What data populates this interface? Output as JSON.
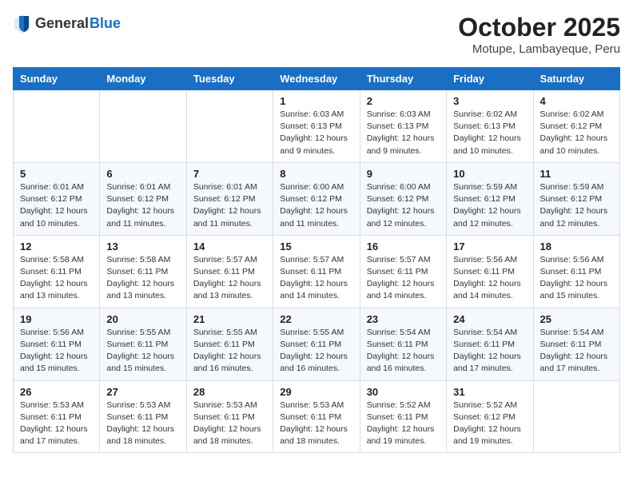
{
  "header": {
    "logo_general": "General",
    "logo_blue": "Blue",
    "month": "October 2025",
    "location": "Motupe, Lambayeque, Peru"
  },
  "days_of_week": [
    "Sunday",
    "Monday",
    "Tuesday",
    "Wednesday",
    "Thursday",
    "Friday",
    "Saturday"
  ],
  "weeks": [
    [
      {
        "day": "",
        "info": ""
      },
      {
        "day": "",
        "info": ""
      },
      {
        "day": "",
        "info": ""
      },
      {
        "day": "1",
        "info": "Sunrise: 6:03 AM\nSunset: 6:13 PM\nDaylight: 12 hours\nand 9 minutes."
      },
      {
        "day": "2",
        "info": "Sunrise: 6:03 AM\nSunset: 6:13 PM\nDaylight: 12 hours\nand 9 minutes."
      },
      {
        "day": "3",
        "info": "Sunrise: 6:02 AM\nSunset: 6:13 PM\nDaylight: 12 hours\nand 10 minutes."
      },
      {
        "day": "4",
        "info": "Sunrise: 6:02 AM\nSunset: 6:12 PM\nDaylight: 12 hours\nand 10 minutes."
      }
    ],
    [
      {
        "day": "5",
        "info": "Sunrise: 6:01 AM\nSunset: 6:12 PM\nDaylight: 12 hours\nand 10 minutes."
      },
      {
        "day": "6",
        "info": "Sunrise: 6:01 AM\nSunset: 6:12 PM\nDaylight: 12 hours\nand 11 minutes."
      },
      {
        "day": "7",
        "info": "Sunrise: 6:01 AM\nSunset: 6:12 PM\nDaylight: 12 hours\nand 11 minutes."
      },
      {
        "day": "8",
        "info": "Sunrise: 6:00 AM\nSunset: 6:12 PM\nDaylight: 12 hours\nand 11 minutes."
      },
      {
        "day": "9",
        "info": "Sunrise: 6:00 AM\nSunset: 6:12 PM\nDaylight: 12 hours\nand 12 minutes."
      },
      {
        "day": "10",
        "info": "Sunrise: 5:59 AM\nSunset: 6:12 PM\nDaylight: 12 hours\nand 12 minutes."
      },
      {
        "day": "11",
        "info": "Sunrise: 5:59 AM\nSunset: 6:12 PM\nDaylight: 12 hours\nand 12 minutes."
      }
    ],
    [
      {
        "day": "12",
        "info": "Sunrise: 5:58 AM\nSunset: 6:11 PM\nDaylight: 12 hours\nand 13 minutes."
      },
      {
        "day": "13",
        "info": "Sunrise: 5:58 AM\nSunset: 6:11 PM\nDaylight: 12 hours\nand 13 minutes."
      },
      {
        "day": "14",
        "info": "Sunrise: 5:57 AM\nSunset: 6:11 PM\nDaylight: 12 hours\nand 13 minutes."
      },
      {
        "day": "15",
        "info": "Sunrise: 5:57 AM\nSunset: 6:11 PM\nDaylight: 12 hours\nand 14 minutes."
      },
      {
        "day": "16",
        "info": "Sunrise: 5:57 AM\nSunset: 6:11 PM\nDaylight: 12 hours\nand 14 minutes."
      },
      {
        "day": "17",
        "info": "Sunrise: 5:56 AM\nSunset: 6:11 PM\nDaylight: 12 hours\nand 14 minutes."
      },
      {
        "day": "18",
        "info": "Sunrise: 5:56 AM\nSunset: 6:11 PM\nDaylight: 12 hours\nand 15 minutes."
      }
    ],
    [
      {
        "day": "19",
        "info": "Sunrise: 5:56 AM\nSunset: 6:11 PM\nDaylight: 12 hours\nand 15 minutes."
      },
      {
        "day": "20",
        "info": "Sunrise: 5:55 AM\nSunset: 6:11 PM\nDaylight: 12 hours\nand 15 minutes."
      },
      {
        "day": "21",
        "info": "Sunrise: 5:55 AM\nSunset: 6:11 PM\nDaylight: 12 hours\nand 16 minutes."
      },
      {
        "day": "22",
        "info": "Sunrise: 5:55 AM\nSunset: 6:11 PM\nDaylight: 12 hours\nand 16 minutes."
      },
      {
        "day": "23",
        "info": "Sunrise: 5:54 AM\nSunset: 6:11 PM\nDaylight: 12 hours\nand 16 minutes."
      },
      {
        "day": "24",
        "info": "Sunrise: 5:54 AM\nSunset: 6:11 PM\nDaylight: 12 hours\nand 17 minutes."
      },
      {
        "day": "25",
        "info": "Sunrise: 5:54 AM\nSunset: 6:11 PM\nDaylight: 12 hours\nand 17 minutes."
      }
    ],
    [
      {
        "day": "26",
        "info": "Sunrise: 5:53 AM\nSunset: 6:11 PM\nDaylight: 12 hours\nand 17 minutes."
      },
      {
        "day": "27",
        "info": "Sunrise: 5:53 AM\nSunset: 6:11 PM\nDaylight: 12 hours\nand 18 minutes."
      },
      {
        "day": "28",
        "info": "Sunrise: 5:53 AM\nSunset: 6:11 PM\nDaylight: 12 hours\nand 18 minutes."
      },
      {
        "day": "29",
        "info": "Sunrise: 5:53 AM\nSunset: 6:11 PM\nDaylight: 12 hours\nand 18 minutes."
      },
      {
        "day": "30",
        "info": "Sunrise: 5:52 AM\nSunset: 6:11 PM\nDaylight: 12 hours\nand 19 minutes."
      },
      {
        "day": "31",
        "info": "Sunrise: 5:52 AM\nSunset: 6:12 PM\nDaylight: 12 hours\nand 19 minutes."
      },
      {
        "day": "",
        "info": ""
      }
    ]
  ]
}
